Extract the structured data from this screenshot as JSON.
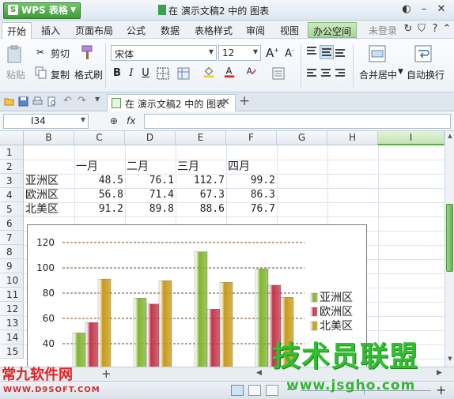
{
  "window": {
    "app_button": "WPS 表格",
    "app_logo": "S",
    "title": "在 演示文稿2 中的 图表"
  },
  "menu": [
    "开始",
    "插入",
    "页面布局",
    "公式",
    "数据",
    "表格样式",
    "审阅",
    "视图",
    "办公空间",
    "未登录"
  ],
  "ribbon": {
    "cut": "剪切",
    "paste": "粘贴",
    "copy": "复制",
    "format_painter": "格式刷",
    "font_name": "宋体",
    "font_size": "12",
    "merge_center": "合并居中",
    "wrap_text": "自动换行"
  },
  "doc_tab": {
    "label": "在 演示文稿2 中的 图表"
  },
  "formula_bar": {
    "cell_ref": "I34",
    "fx": "fx",
    "value": ""
  },
  "columns": [
    "B",
    "C",
    "D",
    "E",
    "F",
    "G",
    "H",
    "I"
  ],
  "selected_column": "I",
  "rows": [
    "1",
    "2",
    "3",
    "4",
    "5",
    "6",
    "7",
    "8",
    "9",
    "10",
    "11",
    "12",
    "13",
    "14",
    "15"
  ],
  "table": {
    "headers": [
      "一月",
      "二月",
      "三月",
      "四月"
    ],
    "body": [
      {
        "label": "亚洲区",
        "values": [
          "48.5",
          "76.1",
          "112.7",
          "99.2"
        ]
      },
      {
        "label": "欧洲区",
        "values": [
          "56.8",
          "71.4",
          "67.3",
          "86.3"
        ]
      },
      {
        "label": "北美区",
        "values": [
          "91.2",
          "89.8",
          "88.6",
          "76.7"
        ]
      }
    ]
  },
  "chart_data": {
    "type": "bar",
    "categories": [
      "一月",
      "二月",
      "三月",
      "四月"
    ],
    "series": [
      {
        "name": "亚洲区",
        "values": [
          48.5,
          76.1,
          112.7,
          99.2
        ],
        "color": "#7fb52e"
      },
      {
        "name": "欧洲区",
        "values": [
          56.8,
          71.4,
          67.3,
          86.3
        ],
        "color": "#c4354a"
      },
      {
        "name": "北美区",
        "values": [
          91.2,
          89.8,
          88.6,
          76.7
        ],
        "color": "#c79a17"
      }
    ],
    "yticks": [
      "40",
      "60",
      "80",
      "100",
      "120"
    ],
    "ylim": [
      40,
      120
    ],
    "grid": true,
    "legend": "right",
    "title": "",
    "xlabel": "",
    "ylabel": ""
  },
  "watermarks": {
    "left": "常九软件网",
    "left_sub": "WWW.D9SOFT.COM",
    "right": "技术员联盟",
    "right_sub": "www.jsgho.com"
  }
}
